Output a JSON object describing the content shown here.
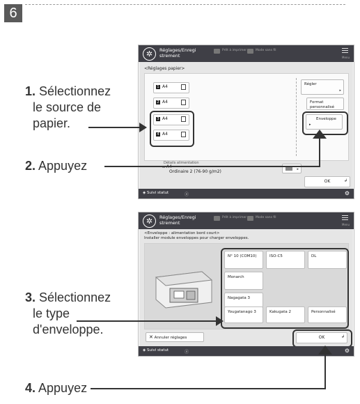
{
  "step_number": "6",
  "instructions": {
    "step1": {
      "num": "1.",
      "lines": [
        "Sélectionnez",
        "le source de",
        "papier."
      ]
    },
    "step2": {
      "num": "2.",
      "text": "Appuyez"
    },
    "step3": {
      "num": "3.",
      "lines": [
        "Sélectionnez",
        "le type",
        "d'enveloppe."
      ]
    },
    "step4": {
      "num": "4.",
      "text": "Appuyez"
    }
  },
  "screen1": {
    "app_title": "Réglages/Enregi strement",
    "tab1": "Prêt à imprimer",
    "tab2": "Mode sans fil",
    "menu_label": "Menu",
    "subtitle": "<Réglages papier>",
    "trays": [
      {
        "num": "1",
        "size": "A4"
      },
      {
        "num": "2",
        "size": "A4"
      },
      {
        "num": "3",
        "size": "A4"
      },
      {
        "num": "4",
        "size": "A4"
      }
    ],
    "right_buttons": {
      "regler": "Régler",
      "format": "Format personnalisé",
      "enveloppe": "Enveloppe"
    },
    "bypass_label": "Détails alimentation",
    "bypass_size": "A4",
    "bypass_type": "Ordinaire 2 (76-90 g/m2)",
    "ok": "OK",
    "status": "Suivi statut"
  },
  "screen2": {
    "app_title": "Réglages/Enregi strement",
    "tab1": "Prêt à imprimer",
    "tab2": "Mode sans fil",
    "menu_label": "Menu",
    "header_line1": "<Enveloppe : alimentation bord court>",
    "header_line2": "Installer module enveloppes pour charger enveloppes.",
    "envelopes": {
      "n10": "N° 10 (COM10)",
      "iso_c5": "ISO-C5",
      "dl": "DL",
      "monarch": "Monarch",
      "nagagata3": "Nagagata 3",
      "yougatanago3": "Yougatanago 3",
      "kakugata2": "Kakugata 2",
      "personnalise": "Personnalisé"
    },
    "cancel": "Annuler réglages",
    "ok": "OK",
    "status": "Suivi statut"
  }
}
